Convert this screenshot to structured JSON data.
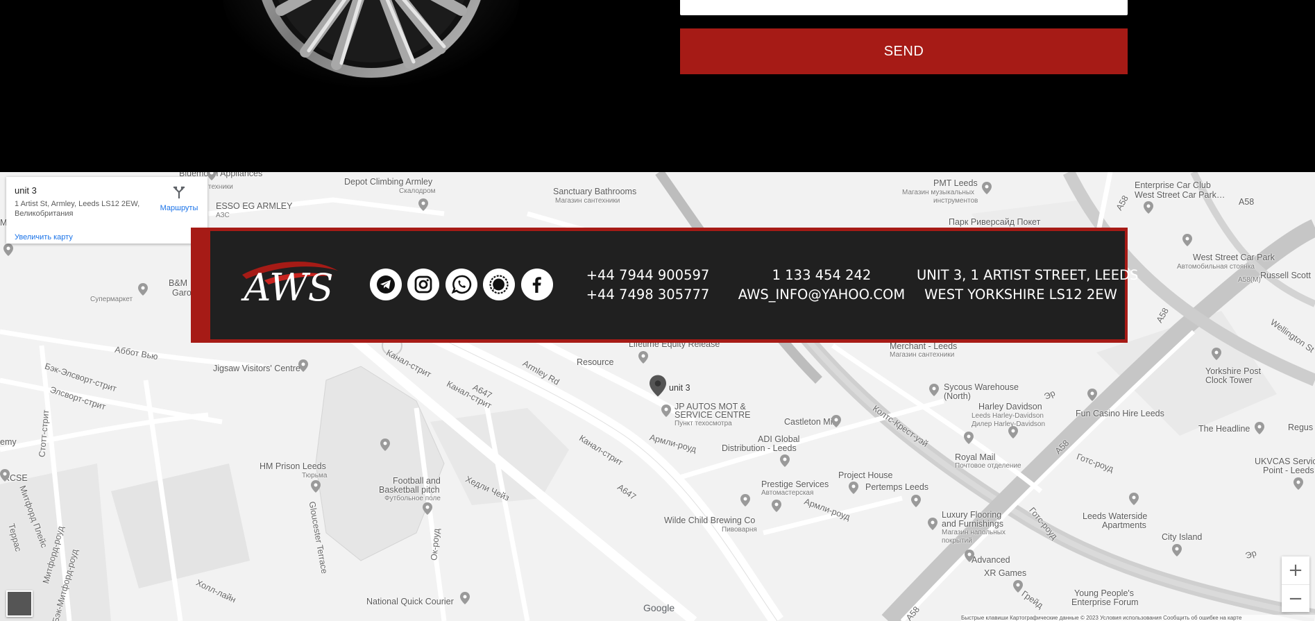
{
  "form": {
    "send_label": "SEND"
  },
  "map": {
    "info": {
      "title": "unit 3",
      "address": "1 Artist St, Armley, Leeds LS12 2EW, Великобритания",
      "directions_label": "Маршруты",
      "enlarge_label": "Увеличить карту"
    },
    "zoom_in": "+",
    "zoom_out": "−",
    "google_label": "Google",
    "attribution": "Быстрые клавиши   Картографические данные © 2023   Условия использования   Сообщить об ошибке на карте",
    "labels": {
      "bluemoon": "Bluemoon Appliances",
      "tekhniki": "техники",
      "esso": "ESSO EG ARMLEY",
      "azs": "АЗС",
      "depot": "Depot Climbing Armley",
      "depot_sub": "Скалодром",
      "sanctuary": "Sanctuary Bathrooms",
      "sanctuary_sub": "Магазин сантехники",
      "pmt": "PMT Leeds",
      "pmt_sub1": "Магазин музыкальных",
      "pmt_sub2": "инструментов",
      "enterprise": "Enterprise Car Club",
      "enterprise2": "West Street Car Park…",
      "a58_top": "A58",
      "park": "Парк Риверсайд Покет",
      "mother": "Mother",
      "bm": "B&M",
      "garo": "Garo",
      "supermarket": "Супермаркет",
      "west_street": "West Street Car Park",
      "west_street_sub": "Автомобильная стоянка",
      "russell": "Russell Scott",
      "a58m": "A58(M)",
      "abbot": "Аббот Вью",
      "bek": "Бэк-Элсворт-стрит",
      "elsvort": "Элсворт-стрит",
      "jigsaw": "Jigsaw Visitors' Centre",
      "lifetime": "Lifetime Equity Release",
      "resource": "Resource",
      "armley_rd": "Armley Rd",
      "merchant": "Merchant - Leeds",
      "merchant_sub": "Магазин сантехники",
      "unit3": "unit 3",
      "jp1": "JP AUTOS MOT &",
      "jp2": "SERVICE CENTRE",
      "jp_sub": "Пункт техосмотра",
      "sycous1": "Sycous Warehouse",
      "sycous2": "(North)",
      "harley": "Harley Davidson",
      "harley_sub1": "Leeds Harley-Davidson",
      "harley_sub2": "Дилер Harley-Davidson",
      "yorkshire1": "Yorkshire Post",
      "yorkshire2": "Clock Tower",
      "fun_casino": "Fun Casino Hire Leeds",
      "headline": "The Headline",
      "wellington": "Wellington St",
      "castleton": "Castleton Mill",
      "adi1": "ADI Global",
      "adi2": "Distribution - Leeds",
      "royal": "Royal Mail",
      "royal_sub": "Почтовое отделение",
      "ukvcas1": "UKVCAS Service",
      "ukvcas2": "Point - Leeds",
      "regus": "Regus",
      "stott": "Стотт-стрит",
      "hm_prison": "HM Prison Leeds",
      "hm_prison_sub": "Тюрьма",
      "football1": "Football and",
      "football2": "Basketball pitch",
      "football_sub": "Футбольное поле",
      "kanal1": "Канал-стрит",
      "kanal2": "Канал-стрит",
      "kanal3": "Канал-стрит",
      "a647_1": "A647",
      "a647_2": "A647",
      "armli_road1": "Армли-роуд",
      "armli_road2": "Армли-роуд",
      "hedli": "Хедли Чейз",
      "ok_road": "Ок-роуд",
      "gloucester": "Gloucester Terrace",
      "project": "Project House",
      "pertemps": "Pertemps Leeds",
      "prestige": "Prestige Services",
      "prestige_sub": "Автомастерская",
      "wilde": "Wilde Child Brewing Co",
      "wilde_sub": "Пивоварня",
      "luxury1": "Luxury Flooring",
      "luxury2": "and Furnishings",
      "luxury_sub1": "Магазин напольных",
      "luxury_sub2": "покрытий",
      "waterside1": "Leeds Waterside",
      "waterside2": "Apartments",
      "city_island": "City Island",
      "advanced": "Advanced",
      "xr": "XR Games",
      "young1": "Young People's",
      "young2": "Enterprise Forum",
      "national": "National Quick Courier",
      "holl": "Холл-лайн",
      "mitford1": "Митфорд-роуд",
      "mitford2": "Бэк-Митфорд-роуд",
      "mitford3": "Митфорд Плейс",
      "a58_mid": "A58",
      "a58_r": "A58",
      "a58_bottom": "A58",
      "a58_left": "A58",
      "kolts": "Колтс-Крест-уэй",
      "gots1": "Готс-роуд",
      "gots2": "Готс-роуд",
      "er1": "Эр",
      "er2": "Эр",
      "greyd": "Грейд",
      "emy": "emy",
      "rcse": "RCSE",
      "terrace": "Террас"
    }
  },
  "contact": {
    "logo_text": "AWS",
    "social": [
      {
        "name": "telegram",
        "icon": "telegram-icon"
      },
      {
        "name": "instagram",
        "icon": "instagram-icon"
      },
      {
        "name": "whatsapp",
        "icon": "whatsapp-icon"
      },
      {
        "name": "signal",
        "icon": "signal-icon"
      },
      {
        "name": "facebook",
        "icon": "facebook-icon"
      }
    ],
    "phone1": "+44 7944 900597",
    "phone2": "+44 7498 305777",
    "phone3": "1 133 454 242",
    "email": "AWS_INFO@YAHOO.COM",
    "address1": "UNIT 3, 1 ARTIST STREET, LEEDS",
    "address2": "WEST YORKSHIRE LS12 2EW"
  },
  "colors": {
    "accent_red": "#a61b16",
    "bar_dark": "#202020",
    "page_black": "#000000"
  }
}
